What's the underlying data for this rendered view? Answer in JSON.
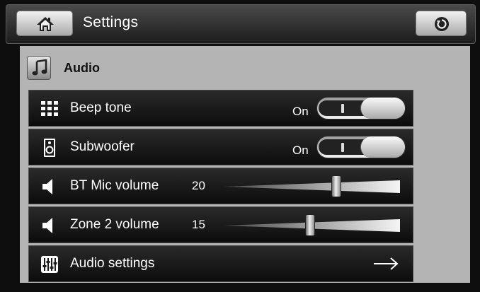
{
  "header": {
    "title": "Settings",
    "home_icon": "home-icon",
    "back_icon": "back-icon"
  },
  "section": {
    "title": "Audio",
    "icon": "music-note-icon"
  },
  "rows": [
    {
      "label": "Beep tone",
      "icon": "keypad-icon",
      "state": "On",
      "checked": true
    },
    {
      "label": "Subwoofer",
      "icon": "speaker-icon",
      "state": "On",
      "checked": true
    },
    {
      "label": "BT Mic volume",
      "icon": "volume-icon",
      "value": "20",
      "level": 0.65
    },
    {
      "label": "Zone 2 volume",
      "icon": "volume-icon",
      "value": "15",
      "level": 0.49
    },
    {
      "label": "Audio settings",
      "icon": "equalizer-icon",
      "arrow_icon": "arrow-right-icon"
    }
  ]
}
